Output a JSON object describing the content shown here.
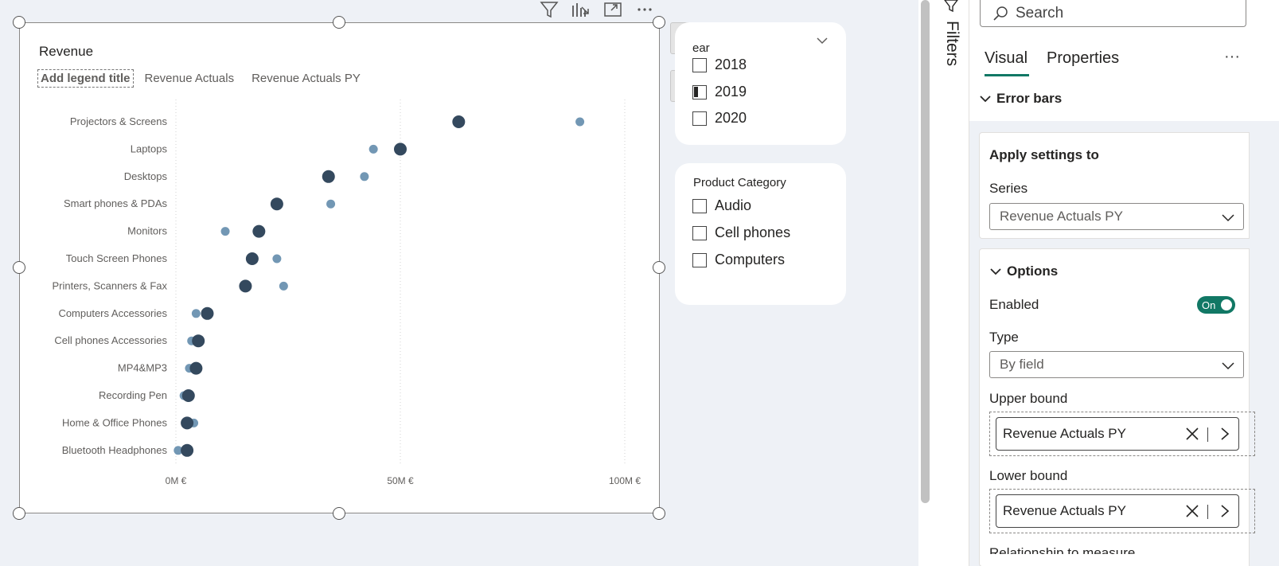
{
  "chart_data": {
    "type": "scatter",
    "title": "Revenue",
    "legend": {
      "title": "Add legend title",
      "placement": "top-left",
      "series_names": [
        "Revenue Actuals",
        "Revenue Actuals PY"
      ]
    },
    "categories": [
      "Projectors & Screens",
      "Laptops",
      "Desktops",
      "Smart phones & PDAs",
      "Monitors",
      "Touch Screen Phones",
      "Printers, Scanners & Fax",
      "Computers Accessories",
      "Cell phones Accessories",
      "MP4&MP3",
      "Recording Pen",
      "Home & Office Phones",
      "Bluetooth Headphones"
    ],
    "series": [
      {
        "name": "Revenue Actuals",
        "color": "#34495e",
        "values": [
          63,
          50,
          34,
          22.5,
          18.5,
          17,
          15.5,
          7,
          5,
          4.5,
          2.8,
          2.5,
          2.5
        ]
      },
      {
        "name": "Revenue Actuals PY",
        "color": "#7297b4",
        "values": [
          90,
          44,
          42,
          34.5,
          11,
          22.5,
          24,
          4.5,
          3.5,
          3,
          1.8,
          4,
          0.5
        ]
      }
    ],
    "x_ticks": [
      "0M €",
      "50M €",
      "100M €"
    ],
    "xlim": [
      0,
      100
    ],
    "grid": "vertical-dotted"
  },
  "slicers": {
    "year": {
      "header": "ear",
      "items": [
        {
          "label": "2018",
          "checked": false
        },
        {
          "label": "2019",
          "checked": true
        },
        {
          "label": "2020",
          "checked": false
        }
      ]
    },
    "category": {
      "header": "Product Category",
      "items": [
        {
          "label": "Audio"
        },
        {
          "label": "Cell phones"
        },
        {
          "label": "Computers"
        }
      ]
    }
  },
  "filters_rail": {
    "label": "Filters"
  },
  "format_pane": {
    "search_placeholder": "Search",
    "tabs": [
      "Visual",
      "Properties"
    ],
    "more": "···",
    "section": "Error bars",
    "apply_settings": {
      "title": "Apply settings to",
      "series_label": "Series",
      "series_value": "Revenue Actuals PY"
    },
    "options": {
      "title": "Options",
      "enabled_label": "Enabled",
      "toggle_text": "On",
      "type_label": "Type",
      "type_value": "By field",
      "upper_label": "Upper bound",
      "upper_value": "Revenue Actuals PY",
      "lower_label": "Lower bound",
      "lower_value": "Revenue Actuals PY",
      "cut_label": "Relationship to measure"
    }
  }
}
